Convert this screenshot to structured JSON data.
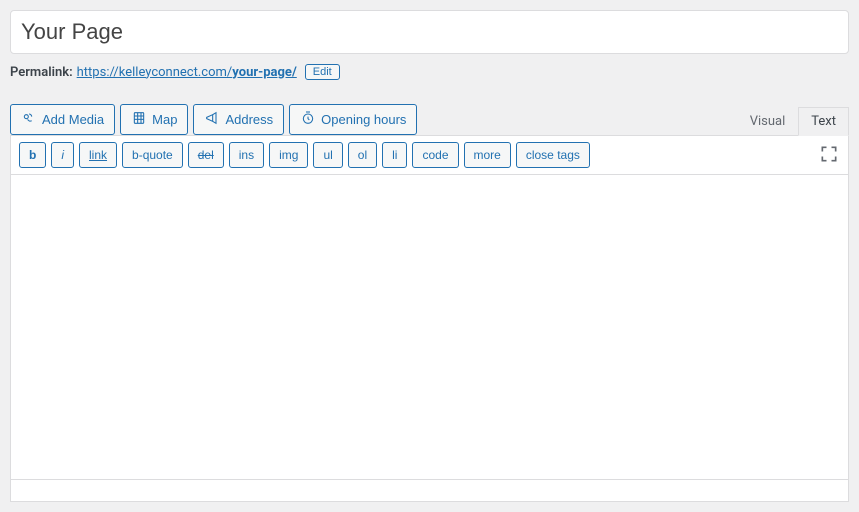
{
  "title": {
    "value": "Your Page"
  },
  "permalink": {
    "label": "Permalink:",
    "base": "https://kelleyconnect.com/",
    "slug": "your-page/",
    "edit_label": "Edit"
  },
  "media_buttons": {
    "add_media": "Add Media",
    "map": "Map",
    "address": "Address",
    "opening_hours": "Opening hours"
  },
  "tabs": {
    "visual": "Visual",
    "text": "Text"
  },
  "quicktags": {
    "b": "b",
    "i": "i",
    "link": "link",
    "bquote": "b-quote",
    "del": "del",
    "ins": "ins",
    "img": "img",
    "ul": "ul",
    "ol": "ol",
    "li": "li",
    "code": "code",
    "more": "more",
    "close": "close tags"
  },
  "content": ""
}
